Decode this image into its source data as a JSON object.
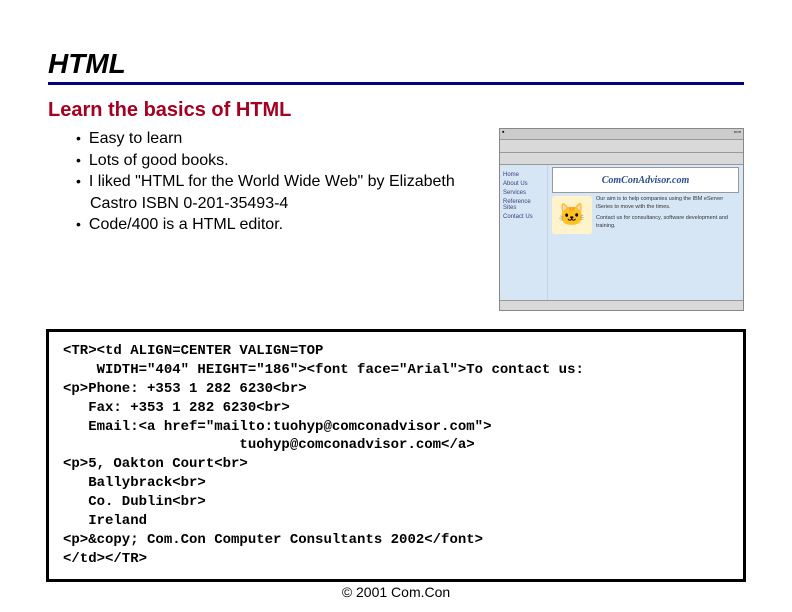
{
  "title": "HTML",
  "subtitle": "Learn the basics of HTML",
  "bullets": {
    "b0": "Easy to learn",
    "b1": "Lots of good books.",
    "b2": "I liked \"HTML for the World Wide Web\" by Elizabeth Castro ISBN 0-201-35493-4",
    "b3": "Code/400 is a HTML editor."
  },
  "browser": {
    "logo": "ComConAdvisor.com",
    "nav": {
      "n0": "Home",
      "n1": "About Us",
      "n2": "Services",
      "n3": "Reference Sites",
      "n4": "Contact Us"
    },
    "blurb1": "Our aim is to help companies using the IBM eServer iSeries to move with the times.",
    "blurb2": "Contact us for consultancy, software development and training."
  },
  "code": "<TR><td ALIGN=CENTER VALIGN=TOP\n    WIDTH=\"404\" HEIGHT=\"186\"><font face=\"Arial\">To contact us:\n<p>Phone: +353 1 282 6230<br>\n   Fax: +353 1 282 6230<br>\n   Email:<a href=\"mailto:tuohyp@comconadvisor.com\">\n                     tuohyp@comconadvisor.com</a>\n<p>5, Oakton Court<br>\n   Ballybrack<br>\n   Co. Dublin<br>\n   Ireland\n<p>&copy; Com.Con Computer Consultants 2002</font>\n</td></TR>",
  "footer": "© 2001 Com.Con"
}
